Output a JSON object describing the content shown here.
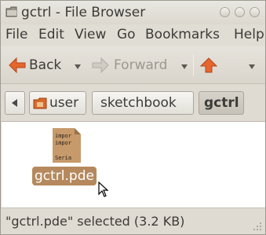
{
  "window": {
    "title": "gctrl - File Browser"
  },
  "menubar": {
    "items": [
      "File",
      "Edit",
      "View",
      "Go",
      "Bookmarks",
      "Help"
    ]
  },
  "toolbar": {
    "back_label": "Back",
    "forward_label": "Forward"
  },
  "pathbar": {
    "crumbs": [
      "user",
      "sketchbook",
      "gctrl"
    ]
  },
  "content": {
    "files": [
      {
        "name": "gctrl.pde",
        "preview_lines": [
          "impor",
          "impor",
          "",
          "Seria"
        ],
        "selected": true
      }
    ]
  },
  "statusbar": {
    "text": "\"gctrl.pde\" selected (3.2 KB)"
  },
  "colors": {
    "selection": "#b5895d",
    "home_icon": "#e5672d",
    "back_arrow": "#e5672d"
  }
}
